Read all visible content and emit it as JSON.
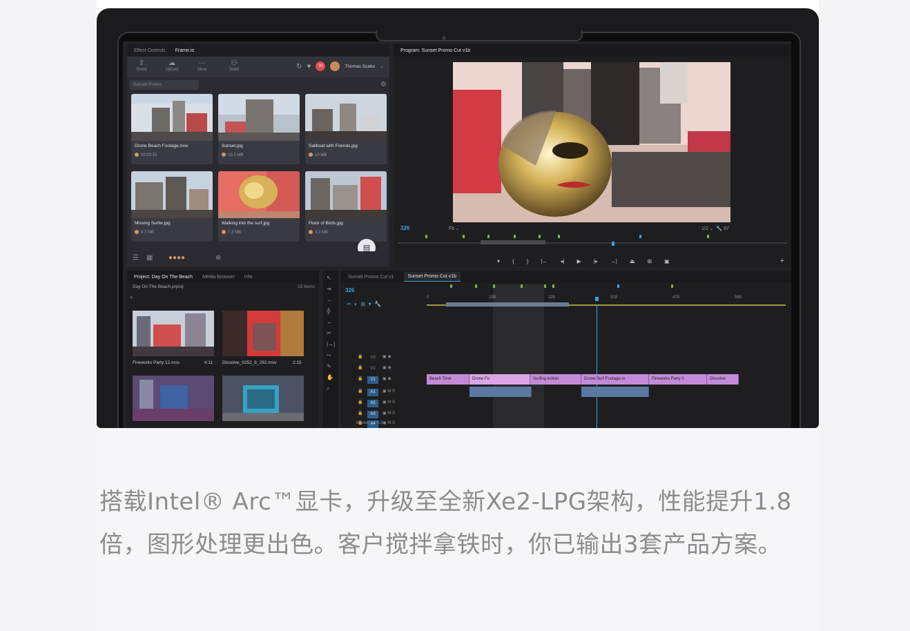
{
  "frameio": {
    "tabs": [
      "Effect Controls",
      "Frame.io"
    ],
    "toolbar": [
      "Share",
      "Upload",
      "More",
      "Team"
    ],
    "notification_count": "20",
    "user": "Thomas Scabo",
    "folder": "Sunset Promo",
    "assets": [
      {
        "name": "Drone Beach Footage.mov",
        "meta": "00:03:15"
      },
      {
        "name": "Sunset.jpg",
        "meta": "10.3 MB"
      },
      {
        "name": "Sailboat with Friends.jpg",
        "meta": "10 MB"
      },
      {
        "name": "Missing Surfer.jpg",
        "meta": "8.7 MB"
      },
      {
        "name": "Walking into the surf.jpg",
        "meta": "7.2 MB"
      },
      {
        "name": "Flock of Birds.jpg",
        "meta": "3.3 MB"
      }
    ]
  },
  "program": {
    "title": "Program: Sunset Promo Cut v1b",
    "timecode": "326",
    "fit": "Fit",
    "ratio": "1/2",
    "end": "97"
  },
  "project": {
    "tabs": [
      "Project: Day On The Beach",
      "Media Browser",
      "Info"
    ],
    "file": "Day On The Beach.prproj",
    "count": "15 Items",
    "clips": [
      {
        "name": "Fireworks Party 12.mov",
        "dur": "4:11"
      },
      {
        "name": "Dissolve_0252_8_292.mov",
        "dur": "2:15"
      }
    ]
  },
  "timeline": {
    "tabs": [
      "Sunset Promo Cut v1",
      "Sunset Promo Cut v1b"
    ],
    "timecode": "326",
    "ruler": [
      "0",
      "159",
      "239",
      "319",
      "479",
      "599"
    ],
    "tracks": [
      "V3",
      "V2",
      "V1",
      "A1",
      "A2",
      "A3",
      "A4"
    ],
    "master": "Master",
    "master_val": "0.0",
    "v1_clips": [
      "Beach Time",
      "Drone Fo",
      "Surfing Action",
      "Drone Surf Footage.m",
      "Fireworks Party 0",
      "Dissolve"
    ]
  },
  "caption": "搭载Intel® Arc™显卡，升级至全新Xe2-LPG架构，性能提升1.8倍，图形处理更出色。客户搅拌拿铁时，你已输出3套产品方案。"
}
